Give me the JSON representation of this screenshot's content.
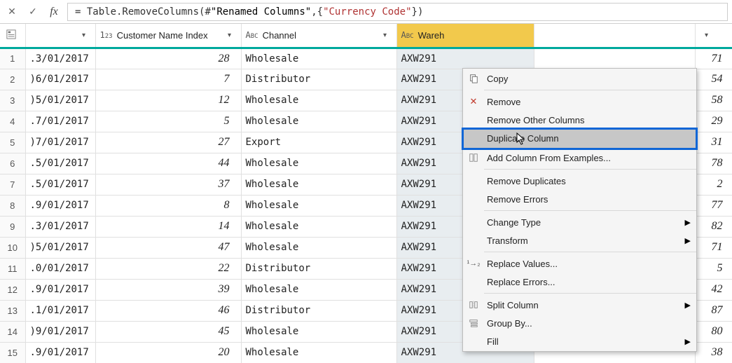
{
  "formula": {
    "eq": "= ",
    "fn": "Table.RemoveColumns",
    "open": "(",
    "step_hash": "#",
    "step": "\"Renamed Columns\"",
    "comma": ",",
    "brace_open": "{",
    "str": "\"Currency Code\"",
    "brace_close": "}",
    "close": ")"
  },
  "columns": {
    "c1_title": "",
    "c2_type": "1²₃",
    "c2_title": "Customer Name Index",
    "c3_typeA": "A",
    "c3_typeB": "B",
    "c3_typeC": "C",
    "c3_title": "Channel",
    "c4_typeA": "A",
    "c4_typeB": "B",
    "c4_typeC": "C",
    "c4_title": "Wareh"
  },
  "rows": [
    {
      "n": "1",
      "date": ".3/01/2017",
      "idx": "28",
      "chan": "Wholesale",
      "wh": "AXW291",
      "v": "71"
    },
    {
      "n": "2",
      "date": ")6/01/2017",
      "idx": "7",
      "chan": "Distributor",
      "wh": "AXW291",
      "v": "54"
    },
    {
      "n": "3",
      "date": ")5/01/2017",
      "idx": "12",
      "chan": "Wholesale",
      "wh": "AXW291",
      "v": "58"
    },
    {
      "n": "4",
      "date": ".7/01/2017",
      "idx": "5",
      "chan": "Wholesale",
      "wh": "AXW291",
      "v": "29"
    },
    {
      "n": "5",
      "date": ")7/01/2017",
      "idx": "27",
      "chan": "Export",
      "wh": "AXW291",
      "v": "31"
    },
    {
      "n": "6",
      "date": ".5/01/2017",
      "idx": "44",
      "chan": "Wholesale",
      "wh": "AXW291",
      "v": "78"
    },
    {
      "n": "7",
      "date": ".5/01/2017",
      "idx": "37",
      "chan": "Wholesale",
      "wh": "AXW291",
      "v": "2"
    },
    {
      "n": "8",
      "date": ".9/01/2017",
      "idx": "8",
      "chan": "Wholesale",
      "wh": "AXW291",
      "v": "77"
    },
    {
      "n": "9",
      "date": ".3/01/2017",
      "idx": "14",
      "chan": "Wholesale",
      "wh": "AXW291",
      "v": "82"
    },
    {
      "n": "10",
      "date": ")5/01/2017",
      "idx": "47",
      "chan": "Wholesale",
      "wh": "AXW291",
      "v": "71"
    },
    {
      "n": "11",
      "date": ".0/01/2017",
      "idx": "22",
      "chan": "Distributor",
      "wh": "AXW291",
      "v": "5"
    },
    {
      "n": "12",
      "date": ".9/01/2017",
      "idx": "39",
      "chan": "Wholesale",
      "wh": "AXW291",
      "v": "42"
    },
    {
      "n": "13",
      "date": ".1/01/2017",
      "idx": "46",
      "chan": "Distributor",
      "wh": "AXW291",
      "v": "87"
    },
    {
      "n": "14",
      "date": ")9/01/2017",
      "idx": "45",
      "chan": "Wholesale",
      "wh": "AXW291",
      "v": "80"
    },
    {
      "n": "15",
      "date": ".9/01/2017",
      "idx": "20",
      "chan": "Wholesale",
      "wh": "AXW291",
      "v": "38"
    }
  ],
  "menu": {
    "copy": "Copy",
    "remove": "Remove",
    "remove_other": "Remove Other Columns",
    "duplicate": "Duplicate Column",
    "add_from_ex": "Add Column From Examples...",
    "remove_dup": "Remove Duplicates",
    "remove_err": "Remove Errors",
    "change_type": "Change Type",
    "transform": "Transform",
    "replace_val": "Replace Values...",
    "replace_err": "Replace Errors...",
    "split_col": "Split Column",
    "group_by": "Group By...",
    "fill": "Fill"
  }
}
